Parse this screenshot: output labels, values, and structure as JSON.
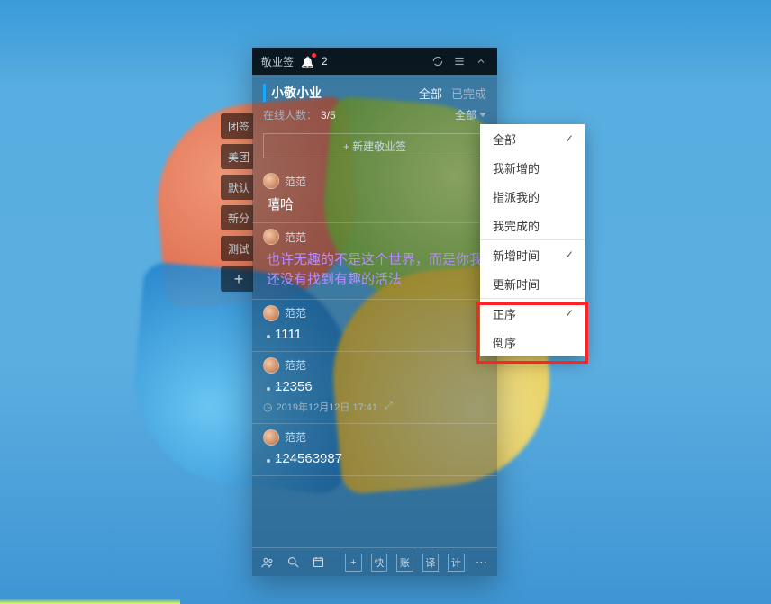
{
  "app_title": "敬业签",
  "notification_count": "2",
  "team_name": "小敬小业",
  "tab_all": "全部",
  "tab_done": "已完成",
  "online_label": "在线人数：",
  "online_value": "3/5",
  "filter_label": "全部",
  "new_note_btn": "+ 新建敬业签",
  "side_tabs": [
    "团签",
    "美团",
    "默认",
    "新分",
    "测试"
  ],
  "notes": [
    {
      "author": "范范",
      "body": "嘻哈",
      "style": "plain"
    },
    {
      "author": "范范",
      "body": "也许无趣的不是这个世界，而是你我还没有找到有趣的活法",
      "style": "purple"
    },
    {
      "author": "范范",
      "body": "1111",
      "style": "plain",
      "dot": true
    },
    {
      "author": "范范",
      "body": "12356",
      "style": "strike",
      "dot": true,
      "meta": "2019年12月12日 17:41"
    },
    {
      "author": "范范",
      "body": "124563987",
      "style": "strike",
      "dot": true
    }
  ],
  "footer_boxes": [
    "快",
    "账",
    "译",
    "计"
  ],
  "dropdown": {
    "groups": [
      {
        "items": [
          {
            "label": "全部",
            "checked": true
          },
          {
            "label": "我新增的",
            "checked": false
          },
          {
            "label": "指派我的",
            "checked": false
          },
          {
            "label": "我完成的",
            "checked": false
          }
        ]
      },
      {
        "items": [
          {
            "label": "新增时间",
            "checked": true
          },
          {
            "label": "更新时间",
            "checked": false
          }
        ]
      },
      {
        "items": [
          {
            "label": "正序",
            "checked": true
          },
          {
            "label": "倒序",
            "checked": false
          }
        ]
      }
    ]
  }
}
